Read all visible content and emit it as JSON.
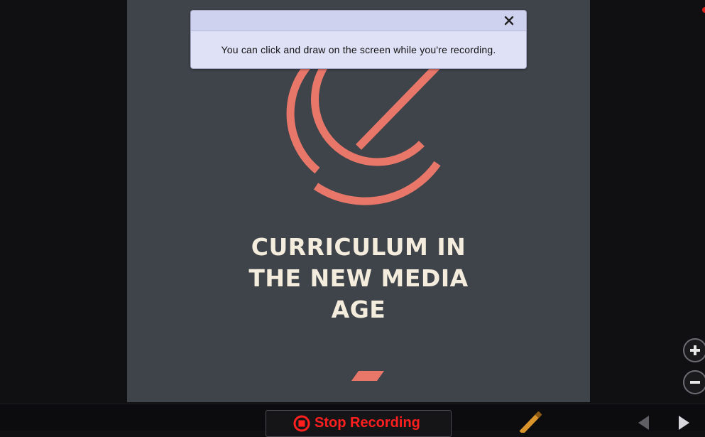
{
  "slide": {
    "title_lines": [
      "CURRICULUM IN",
      "THE NEW MEDIA",
      "AGE"
    ]
  },
  "popup": {
    "message": "You can click and draw on the screen while you're recording.",
    "close_icon": "close-icon"
  },
  "toolbar": {
    "stop_label": "Stop Recording",
    "stop_icon": "stop-circle-icon",
    "pencil_icon": "pencil-icon",
    "prev_icon": "triangle-left-icon",
    "next_icon": "triangle-right-icon"
  },
  "zoom": {
    "in_icon": "plus-icon",
    "out_icon": "minus-icon"
  },
  "colors": {
    "slide_background": "#3f444a",
    "logo": "#e8776a",
    "title_text": "#f4ecdc",
    "popup_background": "#dfe1f6",
    "stop_text": "#ff1f1f"
  }
}
